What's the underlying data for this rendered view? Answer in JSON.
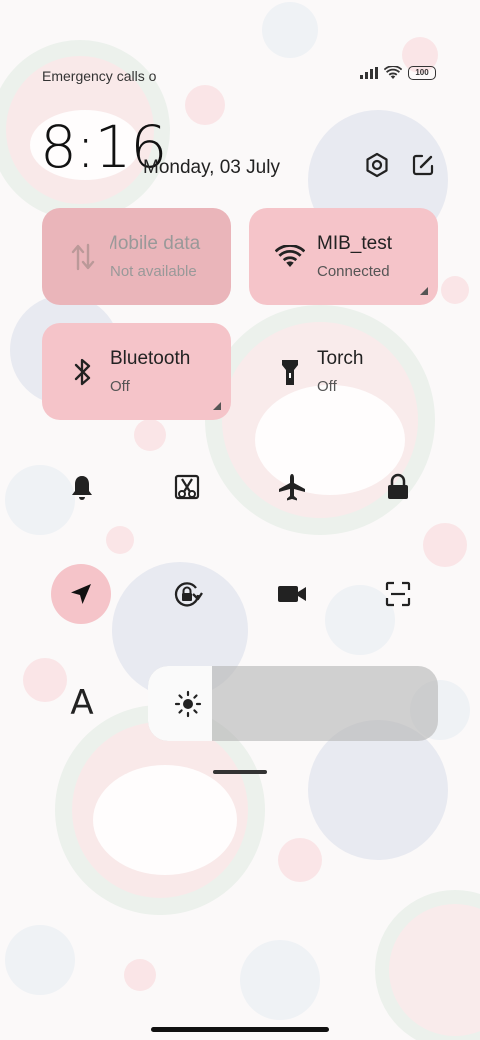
{
  "status_bar": {
    "carrier_text": "Emergency calls o",
    "battery_level": "100",
    "icons": [
      "signal-icon",
      "wifi-icon",
      "battery-icon"
    ]
  },
  "header": {
    "time": "8:16",
    "date": "Monday, 03 July",
    "buttons": [
      "settings-icon",
      "edit-icon"
    ]
  },
  "tiles": {
    "mobile_data": {
      "title": "Mobile data",
      "subtitle": "Not available",
      "icon": "mobile-data-icon",
      "state": "unavailable"
    },
    "wifi": {
      "title": "MIB_test",
      "subtitle": "Connected",
      "icon": "wifi-icon",
      "state": "on"
    },
    "bluetooth": {
      "title": "Bluetooth",
      "subtitle": "Off",
      "icon": "bluetooth-icon",
      "state": "off"
    },
    "torch": {
      "title": "Torch",
      "subtitle": "Off",
      "icon": "torch-icon",
      "state": "off"
    }
  },
  "toggles_row1": [
    {
      "name": "bell-icon",
      "active": false
    },
    {
      "name": "screenshot-icon",
      "active": false
    },
    {
      "name": "airplane-icon",
      "active": false
    },
    {
      "name": "lock-icon",
      "active": false
    }
  ],
  "toggles_row2": [
    {
      "name": "location-icon",
      "active": true
    },
    {
      "name": "rotation-lock-icon",
      "active": false
    },
    {
      "name": "video-camera-icon",
      "active": false
    },
    {
      "name": "scanner-icon",
      "active": false
    }
  ],
  "brightness": {
    "font_label": "A",
    "level_percent": 22,
    "icon": "brightness-icon"
  },
  "colors": {
    "tile_active": "#f5c4c9",
    "tile_unavailable": "#eab5ba",
    "text": "#222222"
  }
}
